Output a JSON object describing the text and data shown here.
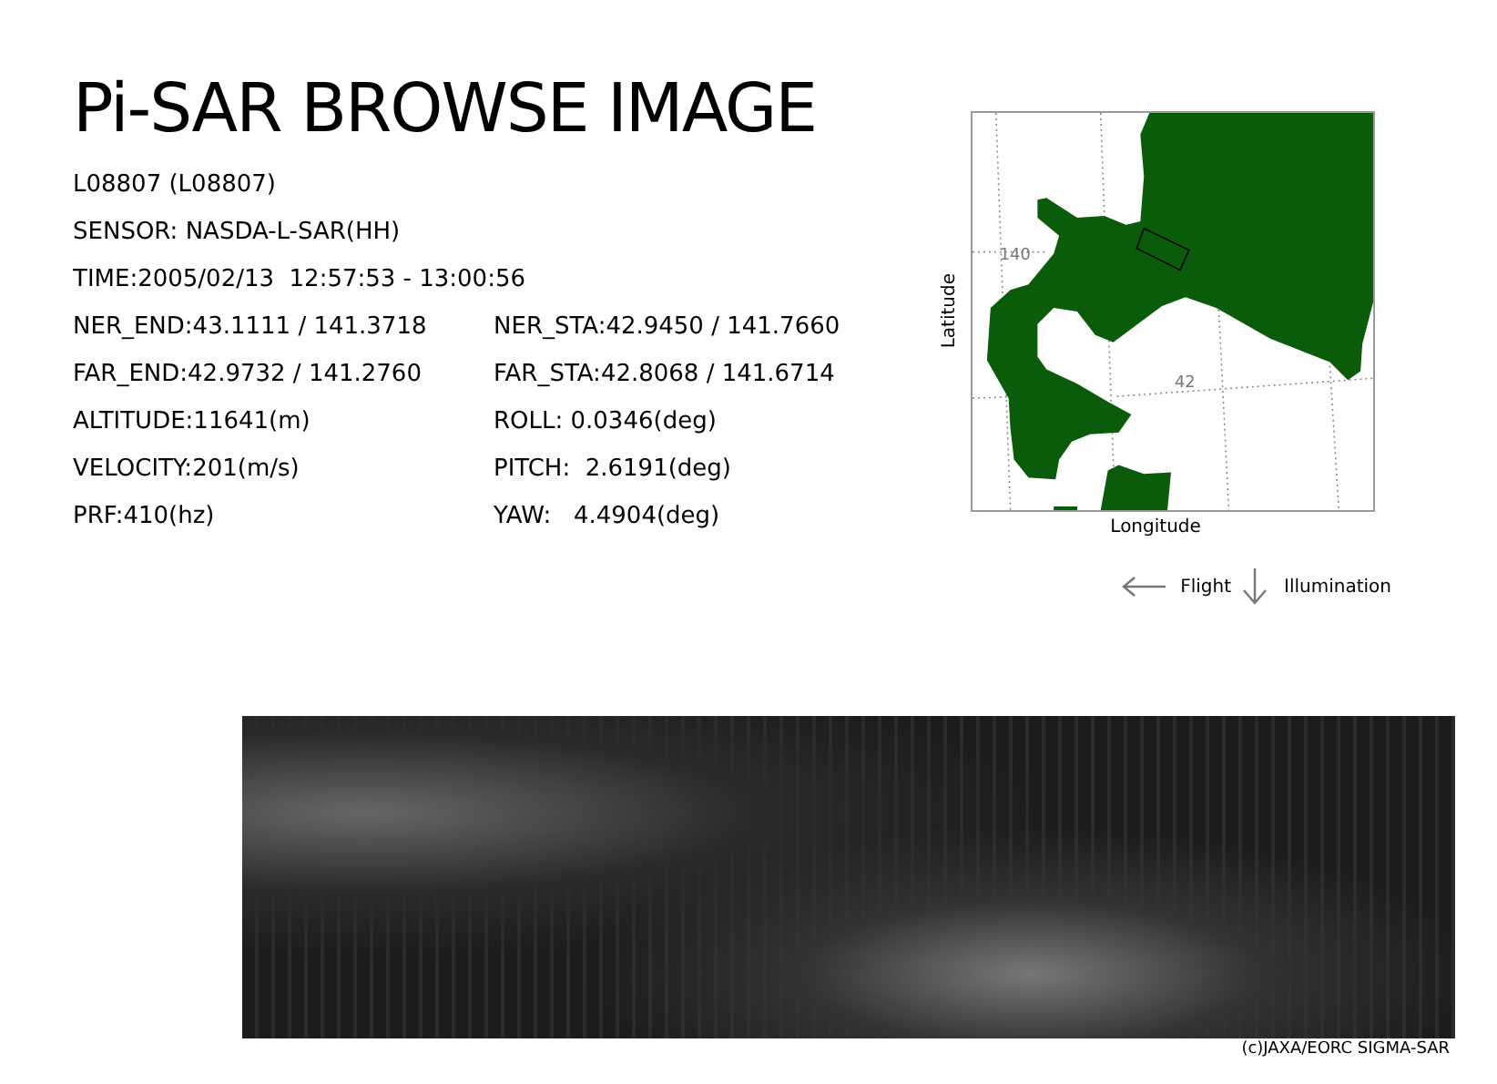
{
  "title": "Pi-SAR BROWSE IMAGE",
  "header_lines": [
    "L08807 (L08807)",
    "SENSOR: NASDA-L-SAR(HH)",
    "TIME:2005/02/13  12:57:53 - 13:00:56"
  ],
  "parameter_rows": [
    {
      "left": "NER_END:43.1111 / 141.3718",
      "right": "NER_STA:42.9450 / 141.7660"
    },
    {
      "left": "FAR_END:42.9732 / 141.2760",
      "right": "FAR_STA:42.8068 / 141.6714"
    },
    {
      "left": "ALTITUDE:11641(m)",
      "right": "ROLL: 0.0346(deg)"
    },
    {
      "left": "VELOCITY:201(m/s)",
      "right": "PITCH:  2.6191(deg)"
    },
    {
      "left": "PRF:410(hz)",
      "right": "YAW:   4.4904(deg)"
    }
  ],
  "location_map": {
    "y_axis_label": "Latitude",
    "x_axis_label": "Longitude",
    "grid_labels": [
      "140",
      "42"
    ]
  },
  "legend": {
    "flight": "Flight",
    "illumination": "Illumination"
  },
  "credit": "(c)JAXA/EORC SIGMA-SAR"
}
